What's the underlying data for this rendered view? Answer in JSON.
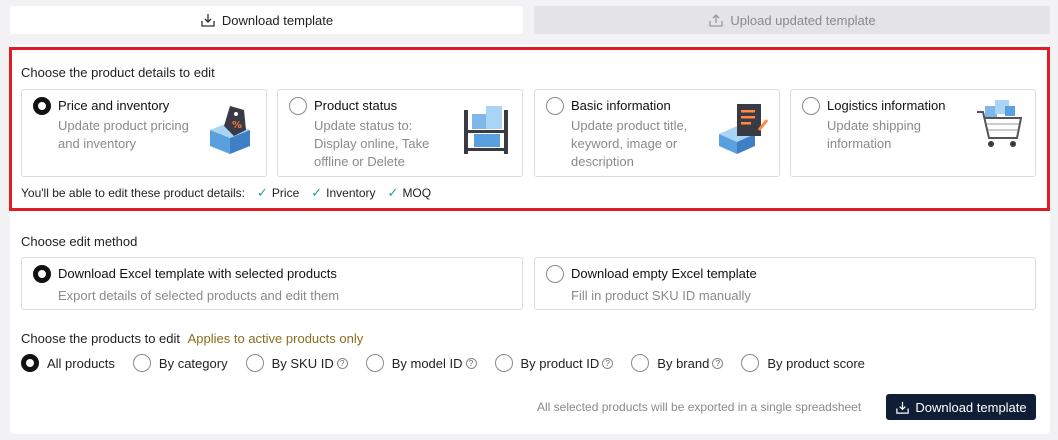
{
  "tabs": {
    "download": "Download template",
    "upload": "Upload updated template"
  },
  "details_section": {
    "title": "Choose the product details to edit",
    "options": [
      {
        "title": "Price and inventory",
        "desc": "Update product pricing and inventory",
        "selected": true,
        "icon": "price-tag-box-icon"
      },
      {
        "title": "Product status",
        "desc": "Update status to: Display online, Take offline or Delete",
        "selected": false,
        "icon": "shelf-boxes-icon"
      },
      {
        "title": "Basic information",
        "desc": "Update product title, keyword, image or description",
        "selected": false,
        "icon": "document-box-icon"
      },
      {
        "title": "Logistics information",
        "desc": "Update shipping information",
        "selected": false,
        "icon": "shopping-cart-icon"
      }
    ],
    "editable_label": "You'll be able to edit these product details:",
    "editable_fields": [
      "Price",
      "Inventory",
      "MOQ"
    ]
  },
  "method_section": {
    "title": "Choose edit method",
    "options": [
      {
        "title": "Download Excel template with selected products",
        "desc": "Export details of selected products and edit them",
        "selected": true
      },
      {
        "title": "Download empty Excel template",
        "desc": "Fill in product SKU ID manually",
        "selected": false
      }
    ]
  },
  "products_section": {
    "title": "Choose the products to edit",
    "note": "Applies to active products only",
    "options": [
      {
        "label": "All products",
        "selected": true,
        "help": false
      },
      {
        "label": "By category",
        "selected": false,
        "help": false
      },
      {
        "label": "By SKU ID",
        "selected": false,
        "help": true
      },
      {
        "label": "By model ID",
        "selected": false,
        "help": true
      },
      {
        "label": "By product ID",
        "selected": false,
        "help": true
      },
      {
        "label": "By brand",
        "selected": false,
        "help": true
      },
      {
        "label": "By product score",
        "selected": false,
        "help": false
      }
    ]
  },
  "footer": {
    "note": "All selected products will be exported in a single spreadsheet",
    "button": "Download template"
  },
  "colors": {
    "highlight": "#e01c24",
    "button_bg": "#0f1d35",
    "check": "#20a39e",
    "note": "#8a6d1e"
  }
}
